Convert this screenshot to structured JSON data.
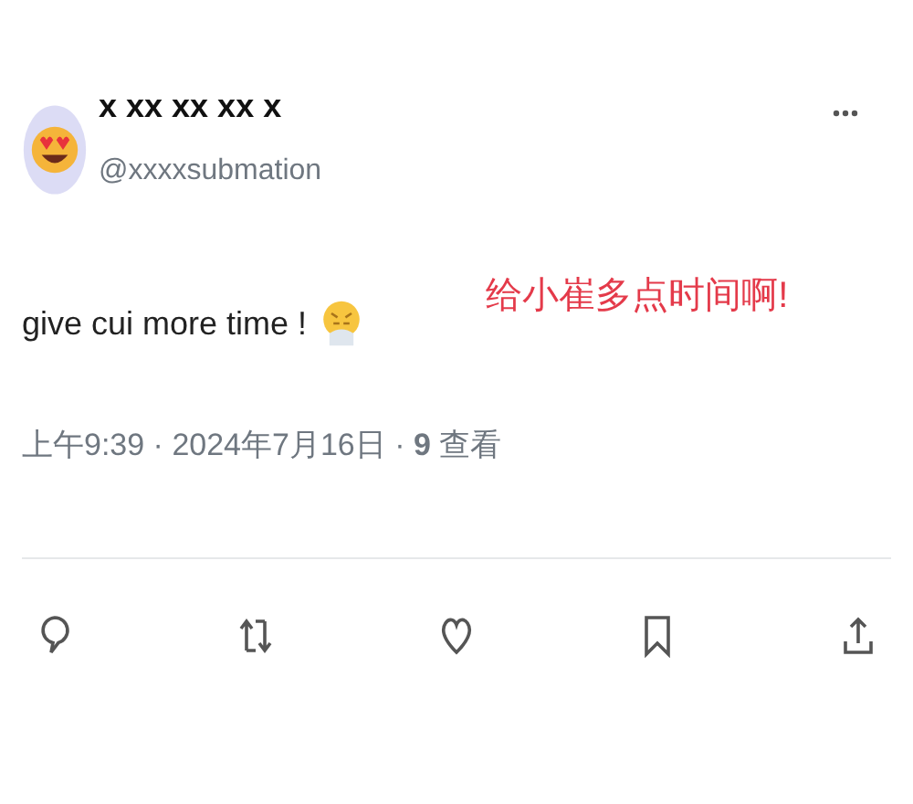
{
  "author": {
    "name": "x xx xx xx x",
    "handle": "@xxxxsubmation"
  },
  "tweet": {
    "text": "give cui more time !",
    "annotation": "给小崔多点时间啊!"
  },
  "meta": "上午9:39 · 2024年7月16日 · **9** 查看",
  "actions": [
    {
      "kind": "reply"
    },
    {
      "kind": "retweet"
    },
    {
      "kind": "like"
    },
    {
      "kind": "bookmark"
    },
    {
      "kind": "share"
    }
  ]
}
